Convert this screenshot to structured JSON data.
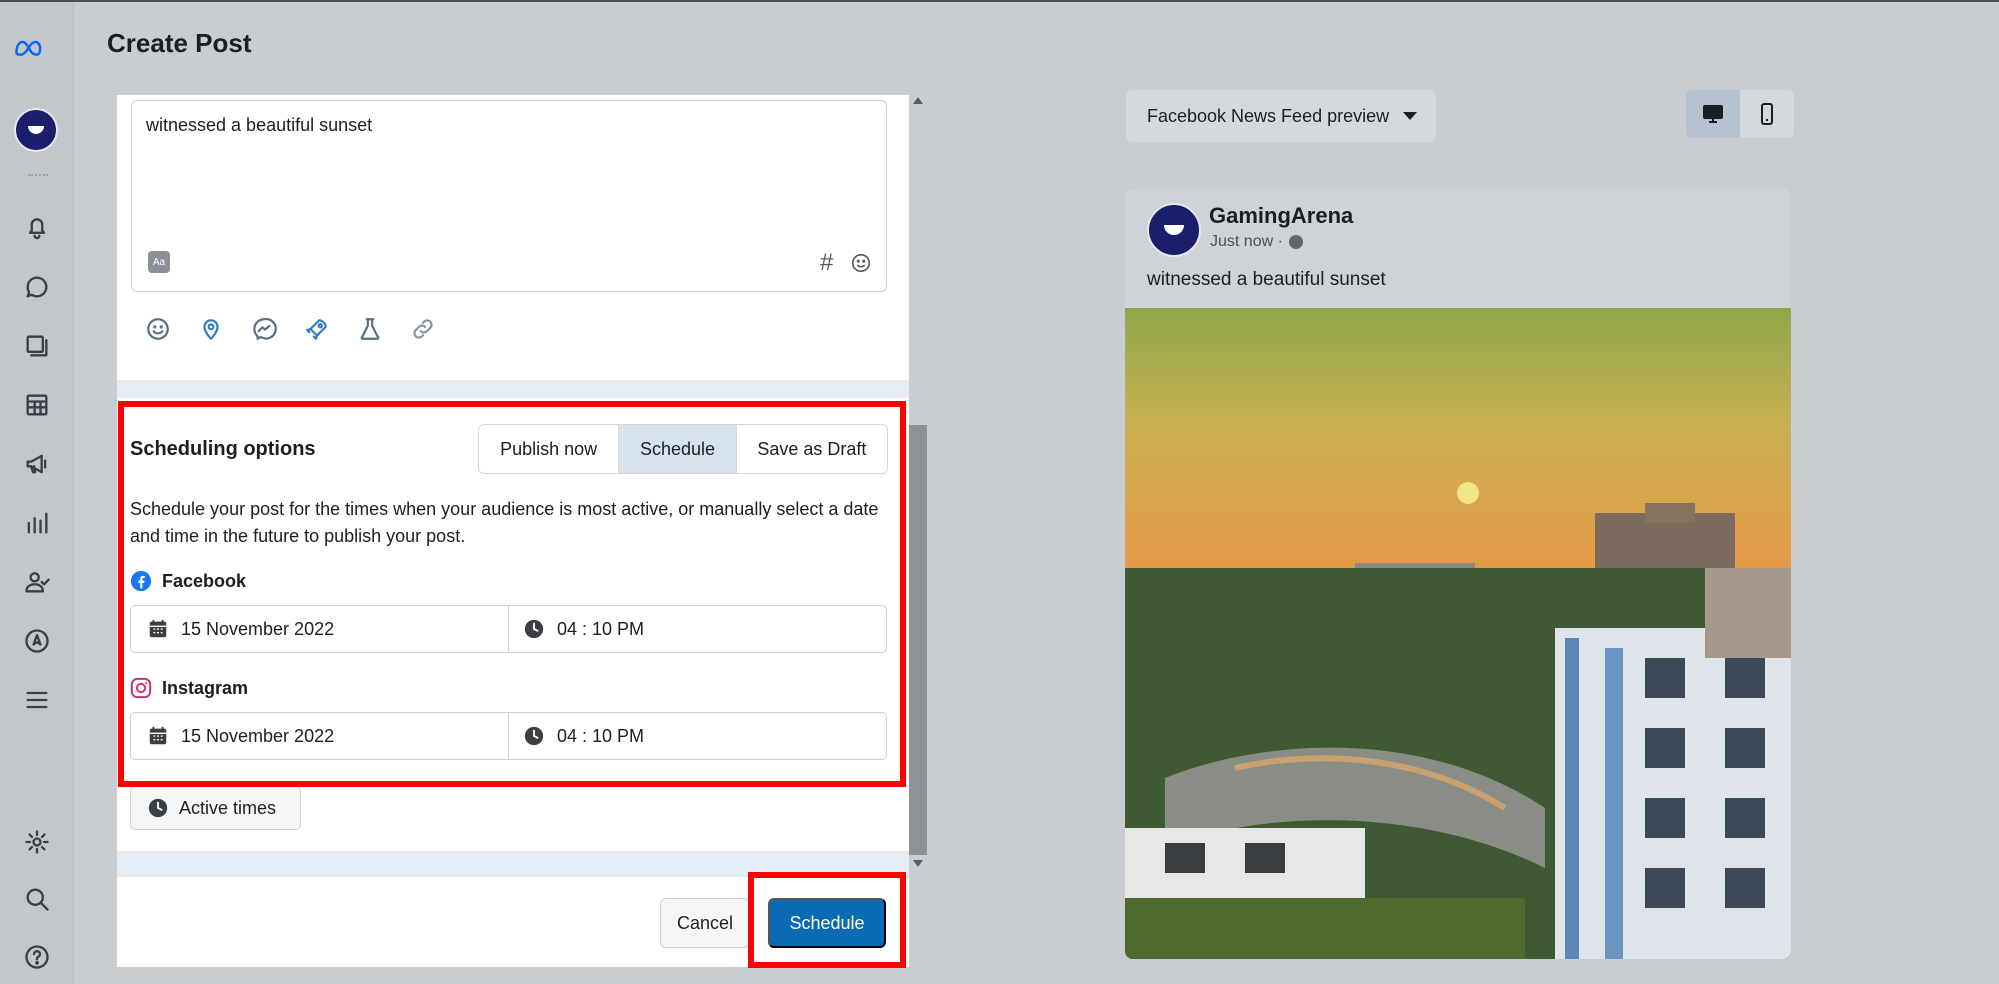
{
  "header": {
    "title": "Create Post"
  },
  "rail": {
    "icons": [
      "meta-logo",
      "bell-icon",
      "chat-icon",
      "pages-icon",
      "table-icon",
      "megaphone-icon",
      "bar-chart-icon",
      "people-icon",
      "compass-icon",
      "menu-icon",
      "gear-icon",
      "search-icon",
      "help-icon"
    ]
  },
  "composer": {
    "text": "witnessed a beautiful sunset",
    "format_label": "Aa",
    "hash_label": "#"
  },
  "scheduling": {
    "title": "Scheduling options",
    "tabs": [
      "Publish now",
      "Schedule",
      "Save as Draft"
    ],
    "selected_tab": "Schedule",
    "description": "Schedule your post for the times when your audience is most active, or manually select a date and time in the future to publish your post.",
    "platforms": [
      {
        "name": "Facebook",
        "date": "15 November 2022",
        "time": "04 : 10 PM",
        "color": "#1877f2"
      },
      {
        "name": "Instagram",
        "date": "15 November 2022",
        "time": "04 : 10 PM",
        "color": "#c13584"
      }
    ],
    "active_times_label": "Active times"
  },
  "footer": {
    "cancel_label": "Cancel",
    "schedule_label": "Schedule",
    "schedule_color": "#0a6ab3"
  },
  "preview": {
    "selector_label": "Facebook News Feed preview",
    "devices": [
      "desktop-icon",
      "mobile-icon"
    ],
    "selected_device": "desktop",
    "post": {
      "page_name": "GamingArena",
      "timestamp": "Just now ·",
      "text": "witnessed a beautiful sunset"
    }
  },
  "highlight_color": "#ff0000"
}
